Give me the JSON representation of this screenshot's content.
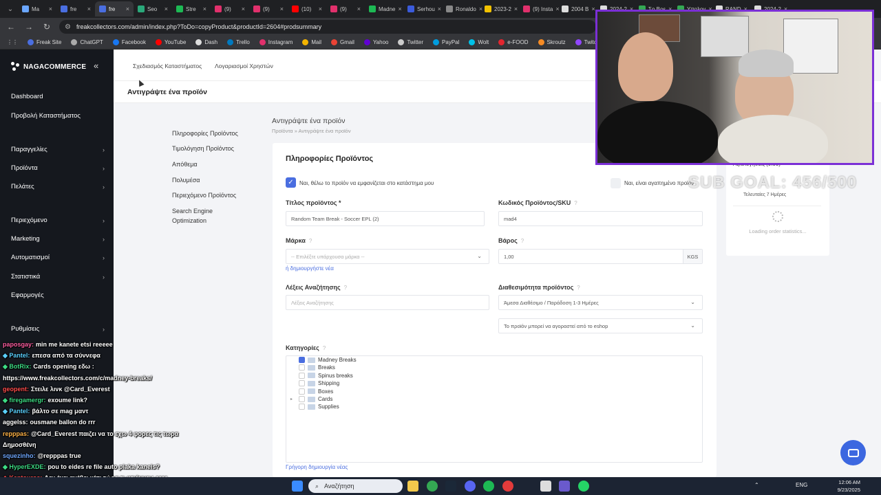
{
  "browser": {
    "tabs": [
      {
        "label": "Ma",
        "color": "#6aa6ff"
      },
      {
        "label": "fre",
        "color": "#4a6ee0"
      },
      {
        "label": "fre",
        "color": "#4a6ee0",
        "active": true
      },
      {
        "label": "Seo",
        "color": "#2aa87a"
      },
      {
        "label": "Stre",
        "color": "#1db954"
      },
      {
        "label": "(9)",
        "color": "#e1306c"
      },
      {
        "label": "(9)",
        "color": "#e1306c"
      },
      {
        "label": "(10)",
        "color": "#ff0000"
      },
      {
        "label": "(9)",
        "color": "#e1306c"
      },
      {
        "label": "Madne",
        "color": "#1db954"
      },
      {
        "label": "Serhou",
        "color": "#3b5bdb"
      },
      {
        "label": "Ronaldo",
        "color": "#888888"
      },
      {
        "label": "2023-2",
        "color": "#f2c200"
      },
      {
        "label": "(9) Insta",
        "color": "#e1306c"
      },
      {
        "label": "2004 B",
        "color": "#dddddd"
      },
      {
        "label": "2024-2",
        "color": "#dddddd"
      },
      {
        "label": "Σο Βρε",
        "color": "#34a853"
      },
      {
        "label": "Υπολογ",
        "color": "#34a853"
      },
      {
        "label": "RAND",
        "color": "#dddddd"
      },
      {
        "label": "2024-2",
        "color": "#dddddd"
      }
    ],
    "url": "freakcollectors.com/admin/index.php?ToDo=copyProduct&productId=2604#prodsummary",
    "bookmarks": [
      {
        "label": "Freak Site",
        "color": "#4a6ee0"
      },
      {
        "label": "ChatGPT",
        "color": "#aaaaaa"
      },
      {
        "label": "Facebook",
        "color": "#1877f2"
      },
      {
        "label": "YouTube",
        "color": "#ff0000"
      },
      {
        "label": "Dash",
        "color": "#dddddd"
      },
      {
        "label": "Trello",
        "color": "#0079bf"
      },
      {
        "label": "Instagram",
        "color": "#e1306c"
      },
      {
        "label": "Mail",
        "color": "#f4b400"
      },
      {
        "label": "Gmail",
        "color": "#ea4335"
      },
      {
        "label": "Yahoo",
        "color": "#6001d2"
      },
      {
        "label": "Twitter",
        "color": "#cccccc"
      },
      {
        "label": "PayPal",
        "color": "#009cde"
      },
      {
        "label": "Wolt",
        "color": "#00c2e8"
      },
      {
        "label": "e-FOOD",
        "color": "#e3262f"
      },
      {
        "label": "Skroutz",
        "color": "#f68b24"
      },
      {
        "label": "Twitch",
        "color": "#9146ff"
      },
      {
        "label": "Kick",
        "color": "#53fc18"
      }
    ]
  },
  "sidebar": {
    "brand": "NAGACOMMERCE",
    "items": [
      {
        "label": "Dashboard",
        "chevron": false
      },
      {
        "label": "Προβολή Καταστήματος",
        "chevron": false
      },
      {
        "label": "Παραγγελίες",
        "chevron": true
      },
      {
        "label": "Προϊόντα",
        "chevron": true
      },
      {
        "label": "Πελάτες",
        "chevron": true
      },
      {
        "label": "Περιεχόμενο",
        "chevron": true
      },
      {
        "label": "Marketing",
        "chevron": true
      },
      {
        "label": "Αυτοματισμοί",
        "chevron": true
      },
      {
        "label": "Στατιστικά",
        "chevron": true
      },
      {
        "label": "Εφαρμογές",
        "chevron": false
      },
      {
        "label": "Ρυθμίσεις",
        "chevron": true
      }
    ]
  },
  "topnav": [
    "Σχεδιασμός Καταστήματος",
    "Λογαριασμοί Χρηστών"
  ],
  "header_title": "Αντιγράψτε ένα προϊόν",
  "subnav": [
    "Πληροφορίες Προϊόντος",
    "Τιμολόγηση Προϊόντος",
    "Απόθεμα",
    "Πολυμέσα",
    "Περιεχόμενο Προϊόντος",
    "Search Engine Optimization"
  ],
  "page": {
    "title": "Αντιγράψτε ένα προϊόν",
    "breadcrumb": "Προϊόντα  »  Αντιγράψτε ένα προϊόν"
  },
  "form": {
    "section_title": "Πληροφορίες Προϊόντος",
    "visible_checkbox_label": "Ναι, θέλω το προϊόν να εμφανίζεται στο κατάστημα μου",
    "favorite_checkbox_label": "Ναι, είναι αγαπημένο προϊόν",
    "name_label": "Τίτλος προϊόντος *",
    "name_value": "Random Team Break - Soccer EPL (2)",
    "sku_label": "Κωδικός Προϊόντος/SKU",
    "sku_value": "mad4",
    "brand_label": "Μάρκα",
    "brand_placeholder": "-- Επιλέξτε υπάρχουσα μάρκα --",
    "brand_create_link": "ή δημιουργήστε νέα",
    "weight_label": "Βάρος",
    "weight_value": "1,00",
    "weight_unit": "KGS",
    "keywords_label": "Λέξεις Αναζήτησης",
    "keywords_placeholder": "Λέξεις Αναζήτησης",
    "availability_label": "Διαθεσιμότητα προϊόντος",
    "availability_value": "Άμεσα Διαθέσιμο / Παράδοση 1-3 Ημέρες",
    "purchase_value": "Το προϊόν μπορεί να αγοραστεί από το eshop",
    "categories_label": "Κατηγορίες",
    "categories": [
      {
        "label": "Madney Breaks",
        "checked": true,
        "expander": false
      },
      {
        "label": "Breaks",
        "checked": false,
        "expander": false
      },
      {
        "label": "Spinus breaks",
        "checked": false,
        "expander": false
      },
      {
        "label": "Shipping",
        "checked": false,
        "expander": false
      },
      {
        "label": "Boxes",
        "checked": false,
        "expander": false
      },
      {
        "label": "Cards",
        "checked": false,
        "expander": true
      },
      {
        "label": "Supplies",
        "checked": false,
        "expander": false
      }
    ],
    "quick_create_link": "Γρήγορη δημιουργία νέας"
  },
  "stats": {
    "title": "Αξιολογήσεις (0.00)",
    "period": "Τελευταίες 7 Ημέρες",
    "loading": "Loading order statistics..."
  },
  "stream": {
    "sub_goal": "SUB GOAL: 456/500",
    "chat": [
      {
        "user": "paposgay:",
        "msg": "min me kanete etsi reeeee",
        "color": "#ff5fa2",
        "icon": false
      },
      {
        "user": "Pantel:",
        "msg": "επεσα από τα σύννεφα",
        "color": "#5ad1ff",
        "icon": true
      },
      {
        "user": "BotRix:",
        "msg": "Cards opening εδω :",
        "color": "#3ddc84",
        "icon": true
      },
      {
        "user": "",
        "msg": "https://www.freakcollectors.com/c/madney-breaks/",
        "color": "#ffffff",
        "icon": false
      },
      {
        "user": "geopent:",
        "msg": "Στειλε λινκ @Card_Everest",
        "color": "#ff4d4d",
        "icon": false
      },
      {
        "user": "firegamergr:",
        "msg": "exoume link?",
        "color": "#3ddc84",
        "icon": true
      },
      {
        "user": "Pantel:",
        "msg": "βάλτο σε mag μαντ",
        "color": "#5ad1ff",
        "icon": true
      },
      {
        "user": "aggelss:",
        "msg": "ousmane ballon do rrr",
        "color": "#ffffff",
        "icon": false
      },
      {
        "user": "repppas:",
        "msg": "@Card_Everest παιζει να το εχω 4 φορες τις τωρα",
        "color": "#ffb347",
        "icon": false
      },
      {
        "user": "",
        "msg": "Δημοσθένη",
        "color": "#ffffff",
        "icon": false
      },
      {
        "user": "squezinho:",
        "msg": "@repppas true",
        "color": "#6fa8ff",
        "icon": false
      },
      {
        "user": "HyperEXDE:",
        "msg": "pou to eides re file auto piaka kaneis?",
        "color": "#3ddc84",
        "icon": true
      },
      {
        "user": "Kantouros:",
        "msg": "Δεν έχει ανέβει κάτι τώρα τι φτιάχνεις εεεε",
        "color": "#ff4d4d",
        "icon": true
      }
    ]
  },
  "taskbar": {
    "search_placeholder": "Αναζήτηση",
    "lang": "ENG",
    "time": "12:06 AM",
    "date": "9/23/2025"
  }
}
